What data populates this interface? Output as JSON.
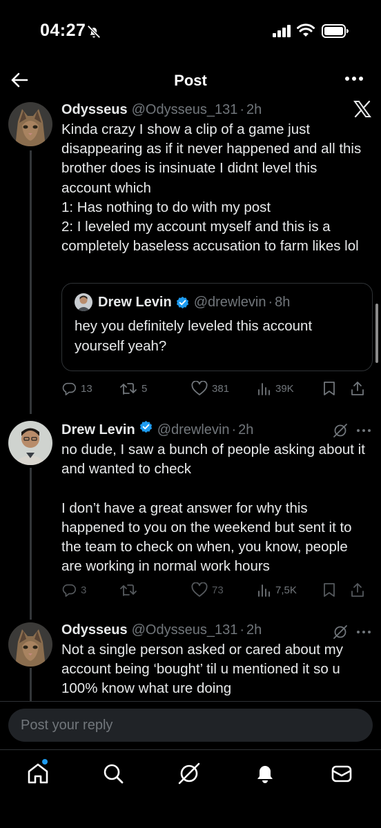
{
  "status_bar": {
    "time": "04:27"
  },
  "header": {
    "title": "Post"
  },
  "posts": [
    {
      "name": "Odysseus",
      "handle": "@Odysseus_131",
      "time": "2h",
      "text": "Kinda crazy I show a clip of a game just disappearing as if it never happened and all this brother does is insinuate I didnt level this account which\n1: Has nothing to do with my post\n2: I leveled my account myself and this is a completely baseless accusation to farm likes lol",
      "quote": {
        "name": "Drew Levin",
        "handle": "@drewlevin",
        "time": "8h",
        "text": "hey you definitely leveled this account yourself yeah?"
      },
      "stats": {
        "replies": "13",
        "reposts": "5",
        "likes": "381",
        "views": "39K"
      }
    },
    {
      "name": "Drew Levin",
      "handle": "@drewlevin",
      "time": "2h",
      "text": "no dude, I saw a bunch of people asking about it and wanted to check\n\nI don’t have a great answer for why this happened to you on the weekend but sent it to the team to check on when, you know, people are working in normal work hours",
      "stats": {
        "replies": "3",
        "reposts": "",
        "likes": "73",
        "views": "7,5K"
      }
    },
    {
      "name": "Odysseus",
      "handle": "@Odysseus_131",
      "time": "2h",
      "text": "Not a single person asked or cared about my account being ‘bought’ til u mentioned it so u 100% know what ure doing"
    }
  ],
  "reply": {
    "placeholder": "Post your reply"
  },
  "colors": {
    "accent": "#1d9bf0",
    "muted": "#71767b",
    "border": "#2f3336"
  },
  "icons": [
    "back-arrow-icon",
    "more-icon",
    "x-logo-icon",
    "grok-icon",
    "verified-icon",
    "reply-icon",
    "repost-icon",
    "like-icon",
    "views-icon",
    "bookmark-icon",
    "share-icon",
    "home-icon",
    "search-icon",
    "notifications-icon",
    "messages-icon"
  ]
}
